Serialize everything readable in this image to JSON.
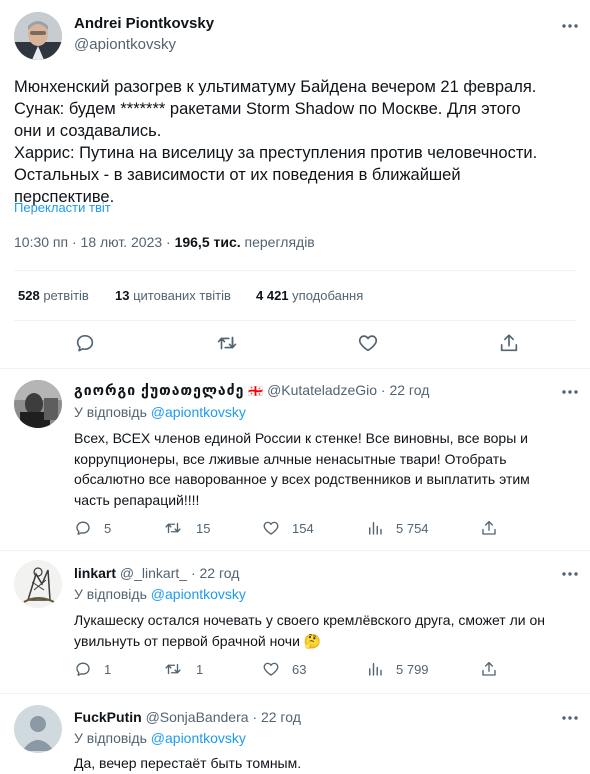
{
  "main_tweet": {
    "author_name": "Andrei Piontkovsky",
    "author_handle": "@apiontkovsky",
    "text_lines": [
      "Мюнхенский разогрев к ультиматуму Байдена вечером 21 февраля.",
      " Сунак:  будем *******  ракетами Storm Shadow по Москве. Для этого",
      "они и создавались.",
      "Харрис: Путина на виселицу за преступления против человечности.",
      "Остальных - в зависимости от их поведения в ближайшей",
      "перспективе."
    ],
    "translate_link": "Перекласти твіт",
    "time": "10:30 пп · 18 лют. 2023 · ",
    "views_count": "196,5 тис.",
    "views_label": " переглядів",
    "retweets_count": "528",
    "retweets_label": " ретвітів",
    "quotes_count": "13",
    "quotes_label": " цитованих твітів",
    "likes_count": "4 421",
    "likes_label": " уподобання"
  },
  "replies": [
    {
      "name": "გიორგი ქუთათელაძე",
      "flag": "🇬🇪",
      "handle": "@KutateladzeGio",
      "time": "· 22 год",
      "reply_prefix": "У відповідь ",
      "reply_to": "@apiontkovsky",
      "text_lines": [
        "Всех, ВСЕХ членов единой России к стенке! Все виновны, все воры и",
        "коррупционеры, все лживые алчные ненасытные твари! Отобрать",
        "обсалютно все наворованное у всех родственников и выплатить этим",
        "часть репараций!!!!"
      ],
      "replies": "5",
      "retweets": "15",
      "likes": "154",
      "views": "5 754"
    },
    {
      "name": "linkart",
      "handle": "@_linkart_",
      "time": "· 22 год",
      "reply_prefix": "У відповідь ",
      "reply_to": "@apiontkovsky",
      "text_lines": [
        "Лукашеску остался ночевать у своего кремлёвского друга, сможет ли он",
        "увильнуть от первой брачной ночи 🤔"
      ],
      "replies": "1",
      "retweets": "1",
      "likes": "63",
      "views": "5 799"
    },
    {
      "name": "FuckPutin",
      "handle": "@SonjaBandera",
      "time": "· 22 год",
      "reply_prefix": "У відповідь ",
      "reply_to": "@apiontkovsky",
      "text_lines": [
        "Да, вечер перестаёт быть томным."
      ]
    }
  ],
  "colors": {
    "accent": "#1d9bf0",
    "muted": "#536471",
    "divider": "#eff3f4"
  },
  "icons": {
    "more": "more-dots-icon",
    "reply": "reply-icon",
    "retweet": "retweet-icon",
    "like": "heart-icon",
    "share": "share-icon",
    "views": "views-chart-icon"
  }
}
